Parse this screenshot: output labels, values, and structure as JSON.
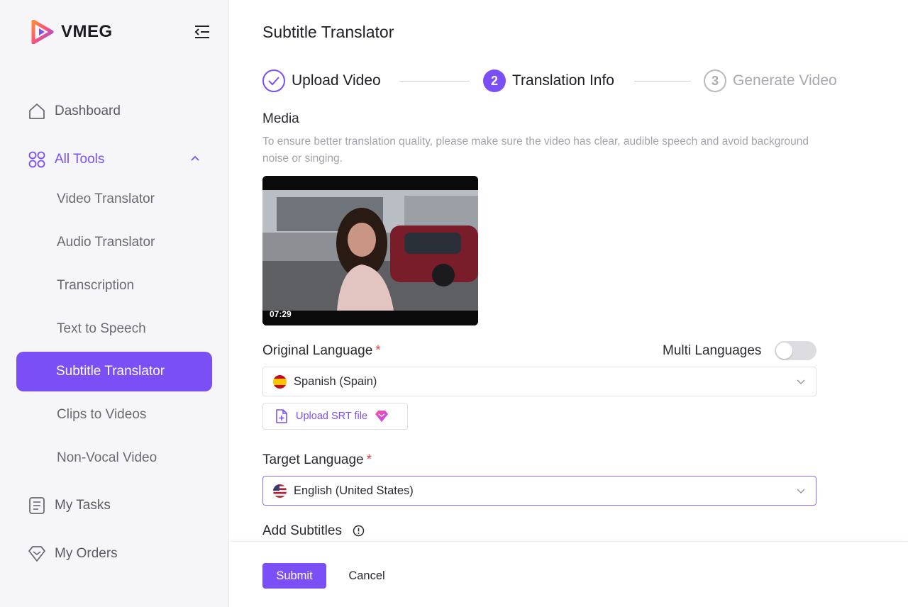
{
  "brand": {
    "name": "VMEG",
    "logo_icon": "vmeg-play-logo"
  },
  "sidebar": {
    "collapse_icon": "sidebar-collapse-icon",
    "dashboard": "Dashboard",
    "all_tools": "All Tools",
    "tools": [
      "Video Translator",
      "Audio Translator",
      "Transcription",
      "Text to Speech",
      "Subtitle Translator",
      "Clips to Videos",
      "Non-Vocal Video"
    ],
    "selected_tool": "Subtitle Translator",
    "my_tasks": "My Tasks",
    "my_orders": "My Orders"
  },
  "main": {
    "title": "Subtitle Translator",
    "steps": [
      {
        "label": "Upload Video",
        "state": "done"
      },
      {
        "number": "2",
        "label": "Translation Info",
        "state": "current"
      },
      {
        "number": "3",
        "label": "Generate Video",
        "state": "pending"
      }
    ],
    "media_label": "Media",
    "media_helper": "To ensure better translation quality, please make sure the video has clear, audible speech and avoid background noise or singing.",
    "video_duration": "07:29",
    "original_language": {
      "label": "Original Language",
      "required_mark": "*",
      "value": "Spanish (Spain)"
    },
    "multi_languages_label": "Multi Languages",
    "multi_languages_on": false,
    "upload_srt_label": "Upload SRT file",
    "target_language": {
      "label": "Target Language",
      "required_mark": "*",
      "value": "English (United States)"
    },
    "add_subtitles_label": "Add Subtitles"
  },
  "footer": {
    "submit_label": "Submit",
    "cancel_label": "Cancel"
  },
  "colors": {
    "accent": "#7b4ff6",
    "required": "#e5484d",
    "sidebar_bg": "#f6f6f8"
  }
}
